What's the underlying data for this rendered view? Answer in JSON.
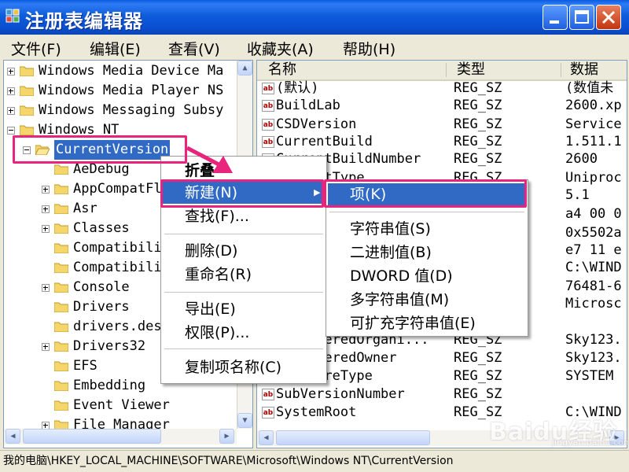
{
  "window": {
    "title": "注册表编辑器"
  },
  "menubar": {
    "items": [
      "文件(F)",
      "编辑(E)",
      "查看(V)",
      "收藏夹(A)",
      "帮助(H)"
    ]
  },
  "tree": {
    "items": [
      {
        "label": "Windows Media Device Ma",
        "expander": "plus"
      },
      {
        "label": "Windows Media Player NS",
        "expander": "plus"
      },
      {
        "label": "Windows Messaging Subsy",
        "expander": "plus"
      },
      {
        "label": "Windows NT",
        "expander": "minus"
      },
      {
        "label": "CurrentVersion",
        "expander": "minus"
      },
      {
        "label": "AeDebug",
        "expander": "none"
      },
      {
        "label": "AppCompatFlags",
        "expander": "plus"
      },
      {
        "label": "Asr",
        "expander": "plus"
      },
      {
        "label": "Classes",
        "expander": "plus"
      },
      {
        "label": "Compatibility",
        "expander": "none"
      },
      {
        "label": "Compatibility32",
        "expander": "none"
      },
      {
        "label": "Console",
        "expander": "plus"
      },
      {
        "label": "Drivers",
        "expander": "none"
      },
      {
        "label": "drivers.desc",
        "expander": "none"
      },
      {
        "label": "Drivers32",
        "expander": "plus"
      },
      {
        "label": "EFS",
        "expander": "none"
      },
      {
        "label": "Embedding",
        "expander": "none"
      },
      {
        "label": "Event Viewer",
        "expander": "none"
      },
      {
        "label": "File Manager",
        "expander": "plus"
      }
    ]
  },
  "list": {
    "columns": [
      "名称",
      "类型",
      "数据"
    ],
    "rows": [
      {
        "name": "(默认)",
        "type": "REG_SZ",
        "data": "(数值未"
      },
      {
        "name": "BuildLab",
        "type": "REG_SZ",
        "data": "2600.xp"
      },
      {
        "name": "CSDVersion",
        "type": "REG_SZ",
        "data": "Service"
      },
      {
        "name": "CurrentBuild",
        "type": "REG_SZ",
        "data": "1.511.1"
      },
      {
        "name": "CurrentBuildNumber",
        "type": "REG_SZ",
        "data": "2600"
      },
      {
        "name": "CurrentType",
        "type": "REG_SZ",
        "data": "Uniproc"
      },
      {
        "name": "",
        "type": "",
        "data": "5.1"
      },
      {
        "name": "",
        "type": "RY",
        "data": "a4 00 0"
      },
      {
        "name": "",
        "type": "D",
        "data": "0x5502a"
      },
      {
        "name": "",
        "type": "RY",
        "data": "e7 11 e"
      },
      {
        "name": "",
        "type": "",
        "data": "C:\\WIND"
      },
      {
        "name": "",
        "type": "",
        "data": "76481-6"
      },
      {
        "name": "",
        "type": "",
        "data": "Microsc"
      },
      {
        "name": "",
        "type": "",
        "data": ""
      },
      {
        "name": "RegisteredOrgani...",
        "type": "REG_SZ",
        "data": "Sky123."
      },
      {
        "name": "RegisteredOwner",
        "type": "REG_SZ",
        "data": "Sky123."
      },
      {
        "name": "SoftwareType",
        "type": "REG_SZ",
        "data": "SYSTEM"
      },
      {
        "name": "SubVersionNumber",
        "type": "REG_SZ",
        "data": ""
      },
      {
        "name": "SystemRoot",
        "type": "REG_SZ",
        "data": "C:\\WIND"
      }
    ]
  },
  "context_menu": {
    "items": [
      "折叠",
      "新建(N)",
      "查找(F)...",
      "删除(D)",
      "重命名(R)",
      "导出(E)",
      "权限(P)...",
      "复制项名称(C)"
    ]
  },
  "submenu": {
    "items": [
      "项(K)",
      "字符串值(S)",
      "二进制值(B)",
      "DWORD 值(D)",
      "多字符串值(M)",
      "可扩充字符串值(E)"
    ]
  },
  "statusbar": {
    "path": "我的电脑\\HKEY_LOCAL_MACHINE\\SOFTWARE\\Microsoft\\Windows NT\\CurrentVersion"
  },
  "watermark": {
    "logo": "Baidu经验",
    "url": "jingyan.baidu.com"
  },
  "colors": {
    "title_blue": "#0a5be0",
    "highlight": "#316ac5",
    "annotation_pink": "#e8247c",
    "close_red": "#c5340e"
  }
}
